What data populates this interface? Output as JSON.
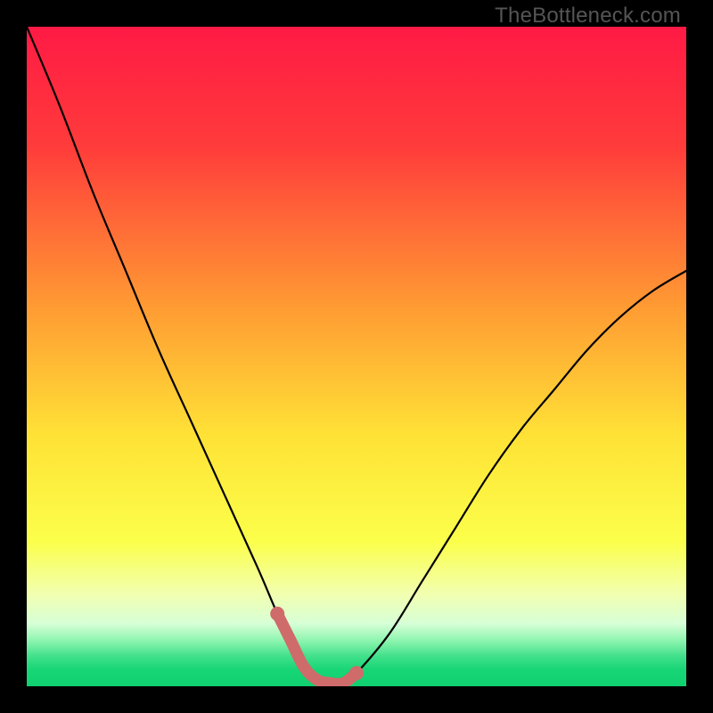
{
  "watermark": "TheBottleneck.com",
  "colors": {
    "background": "#000000",
    "curve": "#000000",
    "highlight": "#cf6b6a",
    "gradient_stops": [
      {
        "offset": 0.0,
        "color": "#ff1a45"
      },
      {
        "offset": 0.18,
        "color": "#ff3b3b"
      },
      {
        "offset": 0.42,
        "color": "#ff9933"
      },
      {
        "offset": 0.62,
        "color": "#ffe236"
      },
      {
        "offset": 0.78,
        "color": "#fbff4a"
      },
      {
        "offset": 0.86,
        "color": "#f2ffb0"
      },
      {
        "offset": 0.905,
        "color": "#d7ffd7"
      },
      {
        "offset": 0.93,
        "color": "#90f5b0"
      },
      {
        "offset": 0.955,
        "color": "#40e08a"
      },
      {
        "offset": 0.975,
        "color": "#17d675"
      },
      {
        "offset": 1.0,
        "color": "#0fd070"
      }
    ]
  },
  "chart_data": {
    "type": "line",
    "title": "",
    "xlabel": "",
    "ylabel": "",
    "xlim": [
      0,
      100
    ],
    "ylim": [
      0,
      100
    ],
    "legend": false,
    "grid": false,
    "series": [
      {
        "name": "bottleneck-curve",
        "x": [
          0,
          5,
          10,
          15,
          20,
          25,
          30,
          35,
          38,
          40,
          42,
          44,
          46,
          48,
          50,
          55,
          60,
          65,
          70,
          75,
          80,
          85,
          90,
          95,
          100
        ],
        "y": [
          100,
          88,
          75,
          63,
          51,
          40,
          29,
          18,
          11,
          7,
          3,
          1,
          0.5,
          0.5,
          2,
          8,
          16,
          24,
          32,
          39,
          45,
          51,
          56,
          60,
          63
        ]
      },
      {
        "name": "bottleneck-highlight",
        "x": [
          38,
          40,
          42,
          44,
          46,
          48,
          50
        ],
        "y": [
          11,
          7,
          3,
          1,
          0.5,
          0.5,
          2
        ]
      }
    ],
    "annotations": [
      {
        "text": "TheBottleneck.com",
        "position": "top-right"
      }
    ]
  }
}
